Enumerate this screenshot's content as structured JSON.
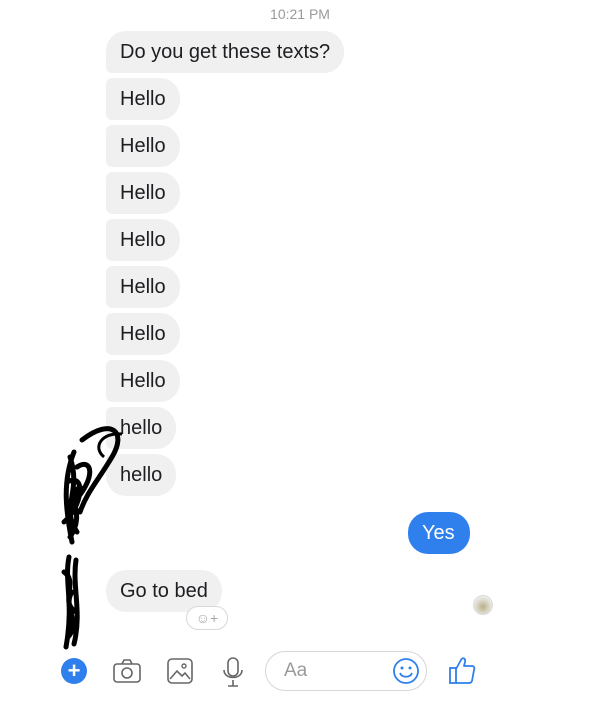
{
  "conversation": {
    "timestamp": "10:21 PM",
    "incoming": [
      {
        "text": "Do you get these texts?"
      },
      {
        "text": "Hello"
      },
      {
        "text": "Hello"
      },
      {
        "text": "Hello"
      },
      {
        "text": "Hello"
      },
      {
        "text": "Hello"
      },
      {
        "text": "Hello"
      },
      {
        "text": "Hello"
      },
      {
        "text": "hello"
      },
      {
        "text": "hello"
      }
    ],
    "outgoing": {
      "text": "Yes"
    },
    "last_incoming": {
      "text": "Go to bed"
    },
    "reaction_hint": "☺+"
  },
  "composer": {
    "placeholder": "Aa",
    "icons": [
      "plus-icon",
      "camera-icon",
      "gallery-icon",
      "microphone-icon",
      "emoji-icon",
      "thumbs-up-icon"
    ]
  },
  "colors": {
    "accent": "#2f80ed",
    "incoming_bubble": "#f1f0f0",
    "timestamp": "#9a9a9a"
  }
}
